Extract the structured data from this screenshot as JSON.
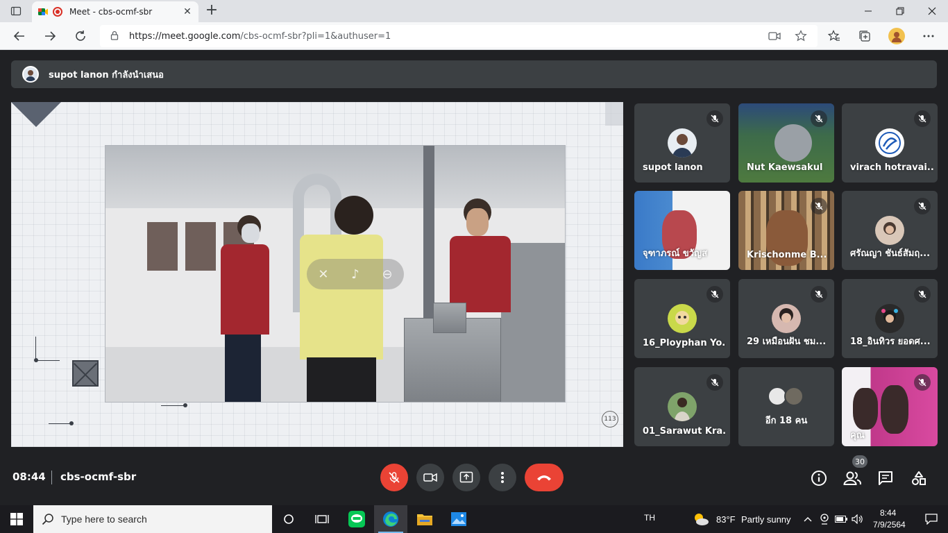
{
  "browser": {
    "tab_title": "Meet - cbs-ocmf-sbr",
    "url_host": "https://meet.google.com",
    "url_path": "/cbs-ocmf-sbr?pli=1&authuser=1"
  },
  "meet": {
    "presenter_text": "supot lanon กำลังนำเสนอ",
    "slide_page_number": "113",
    "meeting_time": "08:44",
    "meeting_code": "cbs-ocmf-sbr",
    "participant_count": "30",
    "participants": [
      {
        "name": "supot lanon"
      },
      {
        "name": "Nut Kaewsakul"
      },
      {
        "name": "virach hotravai..."
      },
      {
        "name": "จุฑาภรณ์ ขวัญส"
      },
      {
        "name": "Krischonme B..."
      },
      {
        "name": "ศรัณญา ชันธ์สัมฤ..."
      },
      {
        "name": "16_Ployphan Yo..."
      },
      {
        "name": "29 เหมือนฝัน ชม..."
      },
      {
        "name": "18_อินทิวร ยอดศ..."
      },
      {
        "name": "01_Sarawut Kra..."
      },
      {
        "name": "อีก 18 คน"
      },
      {
        "name": "คุณ"
      }
    ]
  },
  "taskbar": {
    "search_placeholder": "Type here to search",
    "language": "TH",
    "weather_temp": "83°F",
    "weather_desc": "Partly sunny",
    "clock_time": "8:44",
    "clock_date": "7/9/2564"
  },
  "colors": {
    "meet_bg": "#202124",
    "tile_bg": "#3c4043",
    "danger_red": "#ea4335"
  }
}
